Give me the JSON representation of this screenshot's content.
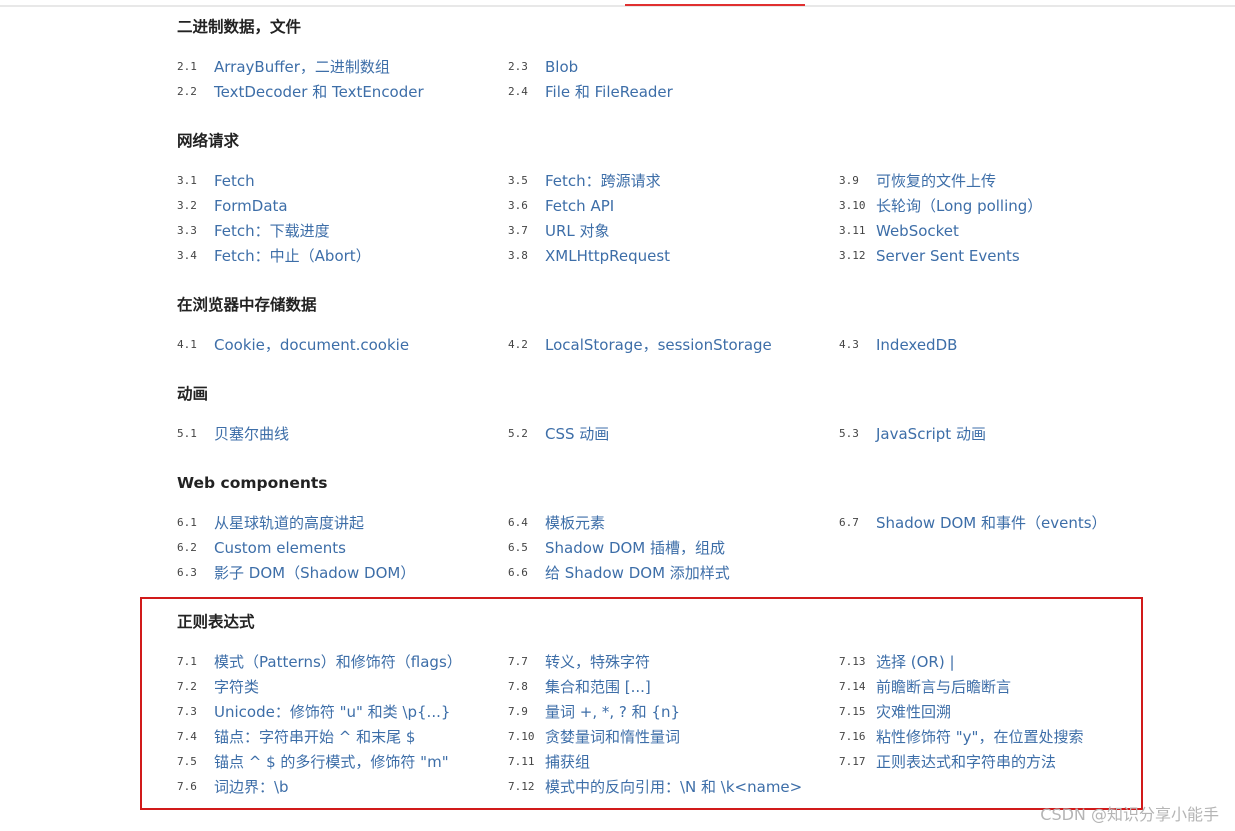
{
  "sections": [
    {
      "title": "二进制数据，文件",
      "columns": [
        [
          {
            "num": "2.1",
            "label": "ArrayBuffer，二进制数组"
          },
          {
            "num": "2.2",
            "label": "TextDecoder 和 TextEncoder"
          }
        ],
        [
          {
            "num": "2.3",
            "label": "Blob"
          },
          {
            "num": "2.4",
            "label": "File 和 FileReader"
          }
        ],
        []
      ]
    },
    {
      "title": "网络请求",
      "columns": [
        [
          {
            "num": "3.1",
            "label": "Fetch"
          },
          {
            "num": "3.2",
            "label": "FormData"
          },
          {
            "num": "3.3",
            "label": "Fetch：下载进度"
          },
          {
            "num": "3.4",
            "label": "Fetch：中止（Abort）"
          }
        ],
        [
          {
            "num": "3.5",
            "label": "Fetch：跨源请求"
          },
          {
            "num": "3.6",
            "label": "Fetch API"
          },
          {
            "num": "3.7",
            "label": "URL 对象"
          },
          {
            "num": "3.8",
            "label": "XMLHttpRequest"
          }
        ],
        [
          {
            "num": "3.9",
            "label": "可恢复的文件上传"
          },
          {
            "num": "3.10",
            "label": "长轮询（Long polling）"
          },
          {
            "num": "3.11",
            "label": "WebSocket"
          },
          {
            "num": "3.12",
            "label": "Server Sent Events"
          }
        ]
      ]
    },
    {
      "title": "在浏览器中存储数据",
      "columns": [
        [
          {
            "num": "4.1",
            "label": "Cookie，document.cookie"
          }
        ],
        [
          {
            "num": "4.2",
            "label": "LocalStorage，sessionStorage"
          }
        ],
        [
          {
            "num": "4.3",
            "label": "IndexedDB"
          }
        ]
      ]
    },
    {
      "title": "动画",
      "columns": [
        [
          {
            "num": "5.1",
            "label": "贝塞尔曲线"
          }
        ],
        [
          {
            "num": "5.2",
            "label": "CSS 动画"
          }
        ],
        [
          {
            "num": "5.3",
            "label": "JavaScript 动画"
          }
        ]
      ]
    },
    {
      "title": "Web components",
      "columns": [
        [
          {
            "num": "6.1",
            "label": "从星球轨道的高度讲起"
          },
          {
            "num": "6.2",
            "label": "Custom elements"
          },
          {
            "num": "6.3",
            "label": "影子 DOM（Shadow DOM）"
          }
        ],
        [
          {
            "num": "6.4",
            "label": "模板元素"
          },
          {
            "num": "6.5",
            "label": "Shadow DOM 插槽，组成"
          },
          {
            "num": "6.6",
            "label": "给 Shadow DOM 添加样式"
          }
        ],
        [
          {
            "num": "6.7",
            "label": "Shadow DOM 和事件（events）"
          }
        ]
      ]
    },
    {
      "title": "正则表达式",
      "columns": [
        [
          {
            "num": "7.1",
            "label": "模式（Patterns）和修饰符（flags）"
          },
          {
            "num": "7.2",
            "label": "字符类"
          },
          {
            "num": "7.3",
            "label": "Unicode：修饰符 \"u\" 和类 \\p{...}"
          },
          {
            "num": "7.4",
            "label": "锚点：字符串开始 ^ 和末尾 $"
          },
          {
            "num": "7.5",
            "label": "锚点 ^ $ 的多行模式，修饰符 \"m\""
          },
          {
            "num": "7.6",
            "label": "词边界：\\b"
          }
        ],
        [
          {
            "num": "7.7",
            "label": "转义，特殊字符"
          },
          {
            "num": "7.8",
            "label": "集合和范围 [...]"
          },
          {
            "num": "7.9",
            "label": "量词 +, *, ? 和 {n}"
          },
          {
            "num": "7.10",
            "label": "贪婪量词和惰性量词"
          },
          {
            "num": "7.11",
            "label": "捕获组"
          },
          {
            "num": "7.12",
            "label": "模式中的反向引用：\\N 和 \\k<name>"
          }
        ],
        [
          {
            "num": "7.13",
            "label": "选择 (OR) |"
          },
          {
            "num": "7.14",
            "label": "前瞻断言与后瞻断言"
          },
          {
            "num": "7.15",
            "label": "灾难性回溯"
          },
          {
            "num": "7.16",
            "label": "粘性修饰符 \"y\"，在位置处搜索"
          },
          {
            "num": "7.17",
            "label": "正则表达式和字符串的方法"
          }
        ]
      ]
    }
  ],
  "watermark": "CSDN @知识分享小能手",
  "colors": {
    "link": "#3d6ea8",
    "highlight": "#d11a1a",
    "accent": "#e03030"
  }
}
